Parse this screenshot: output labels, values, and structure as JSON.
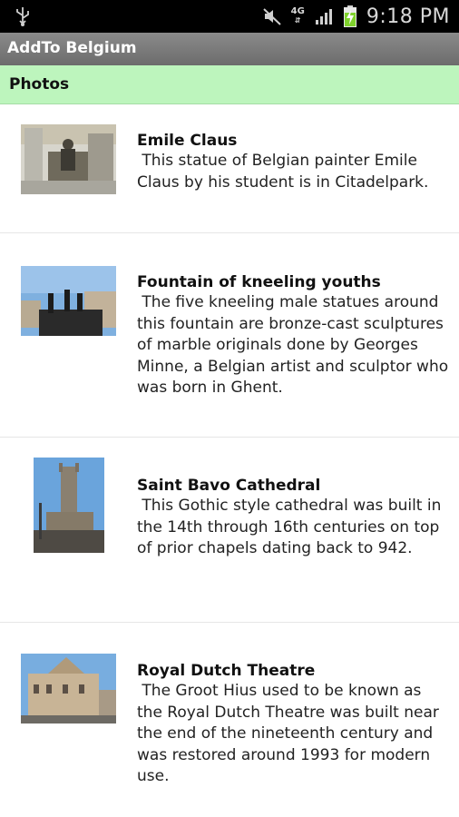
{
  "status_bar": {
    "time": "9:18 PM",
    "network": "4G",
    "icons": [
      "usb-icon",
      "mute-icon",
      "network-4g-icon",
      "signal-icon",
      "battery-charging-icon"
    ]
  },
  "app": {
    "title": "AddTo Belgium"
  },
  "section": {
    "label": "Photos"
  },
  "items": [
    {
      "name": "Emile Claus",
      "description": " This statue of Belgian painter Emile Claus by his student is in Citadelpark."
    },
    {
      "name": "Fountain of kneeling youths",
      "description": " The five kneeling male statues around this fountain are bronze-cast sculptures of marble originals done by Georges Minne, a Belgian artist and sculptor who was born in Ghent."
    },
    {
      "name": "Saint Bavo Cathedral",
      "description": " This Gothic style cathedral was built in the 14th through 16th centuries on top of prior chapels dating back to 942."
    },
    {
      "name": "Royal Dutch Theatre",
      "description": " The Groot Hius used to be known as the Royal Dutch Theatre was built near the end of the nineteenth century and was restored around 1993 for modern use."
    }
  ]
}
